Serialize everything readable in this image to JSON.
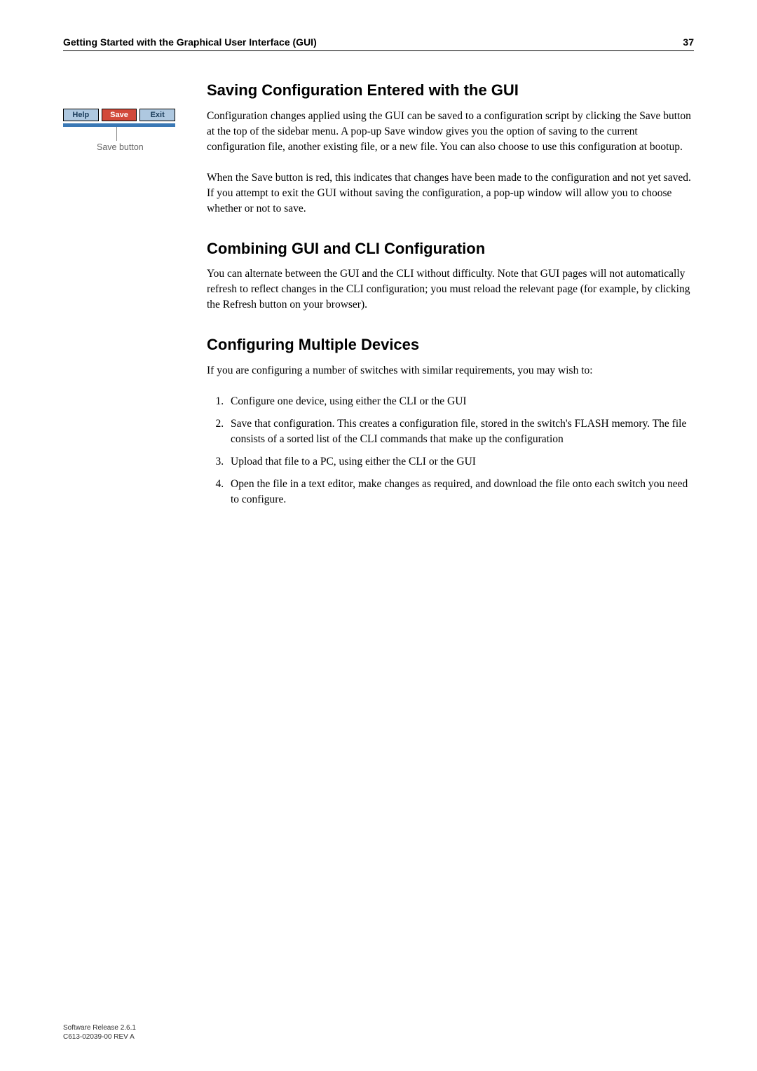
{
  "header": {
    "title": "Getting Started with the Graphical User Interface (GUI)",
    "page_number": "37"
  },
  "diagram": {
    "buttons": {
      "help": "Help",
      "save": "Save",
      "exit": "Exit"
    },
    "callout": "Save button"
  },
  "sections": [
    {
      "heading": "Saving Configuration Entered with the GUI",
      "paragraphs": [
        "Configuration changes applied using the GUI can be saved to a configuration script by clicking the Save button at the top of the sidebar menu. A pop-up Save window gives you the option of saving to the current configuration file, another existing file, or a new file. You can also choose to use this configuration at bootup.",
        "When the Save button is red, this indicates that changes have been made to the configuration and not yet saved. If you attempt to exit the GUI without saving the configuration, a pop-up window will allow you to choose whether or not to save."
      ]
    },
    {
      "heading": "Combining GUI and CLI Configuration",
      "paragraphs": [
        "You can alternate between the GUI and the CLI without difficulty. Note that GUI pages will not automatically refresh to reflect changes in the CLI configuration; you must reload the relevant page (for example, by clicking the Refresh button on your browser)."
      ]
    },
    {
      "heading": "Configuring Multiple Devices",
      "intro": "If you are configuring a number of switches with similar requirements, you may wish to:",
      "list": [
        "Configure one device, using either the CLI or the GUI",
        "Save that configuration. This creates a configuration file, stored in the switch's FLASH memory. The file consists of a sorted list of the CLI commands that make up the configuration",
        "Upload that file to a PC, using either the CLI or the GUI",
        "Open the file in a text editor, make changes as required, and download the file onto each switch you need to configure."
      ]
    }
  ],
  "footer": {
    "release": "Software Release 2.6.1",
    "docid": "C613-02039-00 REV A"
  }
}
